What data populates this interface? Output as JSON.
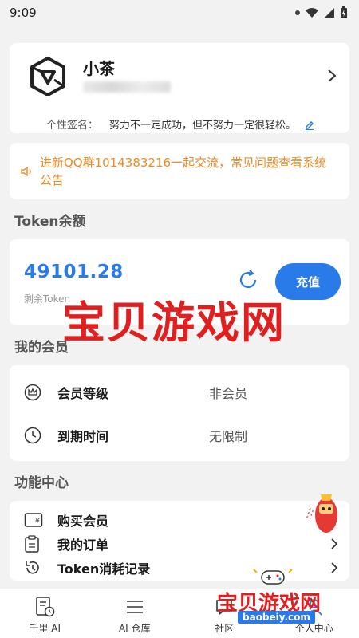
{
  "status_bar": {
    "time": "9:09"
  },
  "profile": {
    "name": "小茶",
    "signature_label": "个性签名：",
    "signature_text": "努力不一定成功，但不努力一定很轻松。"
  },
  "notice": {
    "text": "进新QQ群1014383216一起交流，常见问题查看系统公告"
  },
  "token_section": {
    "title": "Token余额",
    "value": "49101.28",
    "sub_label": "剩余Token",
    "recharge_label": "充值"
  },
  "membership": {
    "title": "我的会员",
    "rows": [
      {
        "label": "会员等级",
        "value": "非会员"
      },
      {
        "label": "到期时间",
        "value": "无限制"
      }
    ]
  },
  "functions": {
    "title": "功能中心",
    "items": [
      {
        "label": "购买会员"
      },
      {
        "label": "我的订单"
      },
      {
        "label": "Token消耗记录"
      }
    ]
  },
  "bottom_nav": [
    {
      "label": "千里 AI"
    },
    {
      "label": "AI 仓库"
    },
    {
      "label": "社区"
    },
    {
      "label": "个人中心"
    }
  ],
  "watermark": {
    "big": "宝贝游戏网",
    "small": "宝贝游戏网",
    "url": "baobeiy.com"
  },
  "colors": {
    "accent": "#2a7bea",
    "notice": "#f08a24",
    "watermark": "#e02020"
  }
}
